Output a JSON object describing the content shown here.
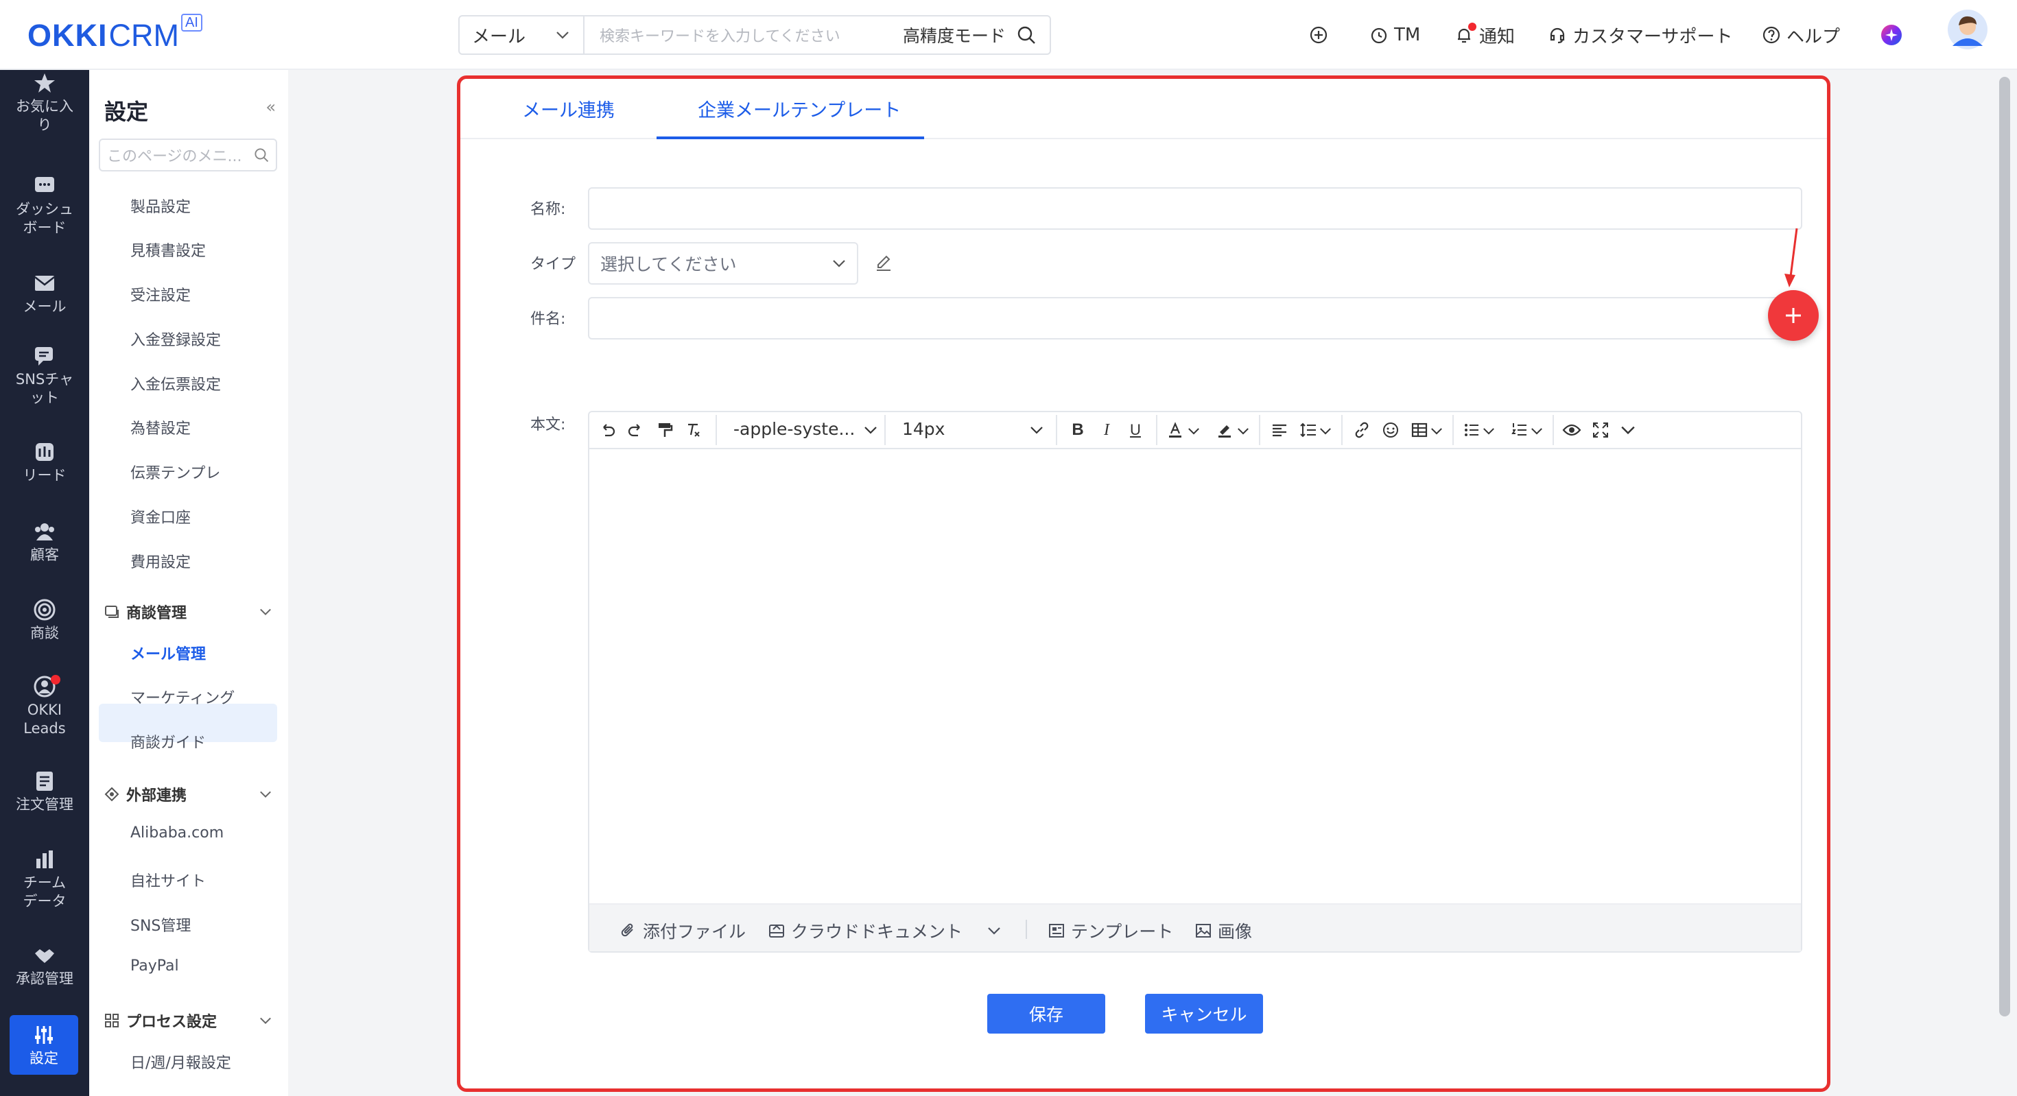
{
  "app": {
    "logo_main": "OKKI",
    "logo_sub": "CRM",
    "logo_badge": "AI"
  },
  "search": {
    "scope": "メール",
    "placeholder": "検索キーワードを入力してください",
    "mode": "高精度モード"
  },
  "topnav": {
    "tm": "TM",
    "notify": "通知",
    "support": "カスタマーサポート",
    "help": "ヘルプ"
  },
  "leftnav": [
    {
      "label": "お気に入り"
    },
    {
      "label": "ダッシュボード"
    },
    {
      "label": "メール"
    },
    {
      "label": "SNSチャット"
    },
    {
      "label": "リード"
    },
    {
      "label": "顧客"
    },
    {
      "label": "商談"
    },
    {
      "label": "OKKI Leads"
    },
    {
      "label": "注文管理"
    },
    {
      "label": "チームデータ"
    },
    {
      "label": "承認管理"
    },
    {
      "label": "設定"
    }
  ],
  "sidebar": {
    "title": "設定",
    "collapse": "«",
    "search_placeholder": "このページのメニ...",
    "items_a": [
      "製品設定",
      "見積書設定",
      "受注設定",
      "入金登録設定",
      "入金伝票設定",
      "為替設定",
      "伝票テンプレ",
      "資金口座",
      "費用設定"
    ],
    "group_deal": "商談管理",
    "items_b": [
      "メール管理",
      "マーケティング",
      "商談ガイド"
    ],
    "group_ext": "外部連携",
    "items_c": [
      "Alibaba.com",
      "自社サイト",
      "SNS管理",
      "PayPal"
    ],
    "group_process": "プロセス設定",
    "items_d": [
      "日/週/月報設定"
    ]
  },
  "tabs": [
    "メール連携",
    "企業メールテンプレート"
  ],
  "form": {
    "name_label": "名称:",
    "type_label": "タイプ",
    "type_placeholder": "選択してください",
    "subject_label": "件名:",
    "body_label": "本文:"
  },
  "editor": {
    "font": "-apple-syste...",
    "size": "14px",
    "attach": "添付ファイル",
    "cloud": "クラウドドキュメント",
    "template": "テンプレート",
    "image": "画像"
  },
  "buttons": {
    "save": "保存",
    "cancel": "キャンセル"
  },
  "colors": {
    "brand": "#1f5be0",
    "primary": "#2f6ef2",
    "annotation": "#e8302f",
    "fab": "#f0383b",
    "nav_bg": "#1d2336"
  }
}
